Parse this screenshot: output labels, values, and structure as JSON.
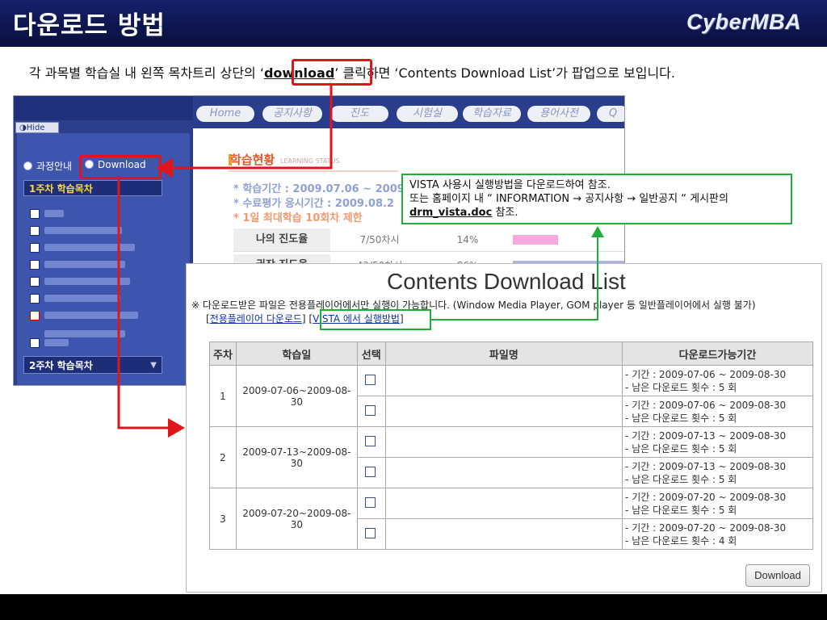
{
  "slide": {
    "title": "다운로드 방법",
    "brand": "CyberMBA",
    "instruction_pre": "각 과목별 학습실 내 왼쪽 목차트리 상단의 ‘",
    "instruction_kw": "download",
    "instruction_post": "’ 클릭하면 ‘Contents Download List’가 팝업으로 보입니다."
  },
  "lms": {
    "hide_label": "Hide",
    "side_tabs": [
      "과정안내",
      "Download"
    ],
    "week1_label": "1주차 학습목차",
    "week2_label": "2주차 학습목차",
    "week2_dropdown": "▼",
    "nav_tabs": [
      "Home",
      "공지사항",
      "진도",
      "시험실",
      "학습자료",
      "용어사전",
      "Q"
    ],
    "section_title": "학습현황",
    "section_sub": "LEARNING STATUS",
    "lines": [
      "* 학습기간 : 2009.07.06 ~ 2009",
      "* 수료평가 응시기간 : 2009.08.2",
      "* 1일 최대학습 10회차 제한"
    ],
    "progress": [
      {
        "label": "나의 진도율",
        "value": "7/50차시",
        "pct": "14%",
        "fraction": 0.14,
        "color": "#f7a8e0"
      },
      {
        "label": "권장 진도율",
        "value": "43/50차시",
        "pct": "86%",
        "fraction": 0.86,
        "color": "#aab4dc"
      }
    ]
  },
  "callout": {
    "line1": "VISTA 사용시 실행방법을 다운로드하여 참조.",
    "line2": "또는 홈페이지 내 “ INFORMATION → 공지사항 → 일반공지 “ 게시판의",
    "doc_name": "drm_vista.doc",
    "line3_suffix": " 참조."
  },
  "popup": {
    "title": "Contents Download List",
    "notice": "※ 다운로드받은 파일은 전용플레이어에서만 실행이 가능합니다. (Window Media Player, GOM player 등 일반플레이어에서 실행 불가)",
    "player_link": "전용플레이어 다운로드",
    "vista_link": "VISTA 에서 실행방법",
    "columns": [
      "주차",
      "학습일",
      "선택",
      "파일명",
      "다운로드가능기간"
    ],
    "weeks": [
      {
        "week": "1",
        "date": "2009-07-06~2009-08-30",
        "rows": [
          {
            "period": "- 기간 : 2009-07-06 ~ 2009-08-30",
            "remaining": "- 남은 다운로드 횟수 : 5 회"
          },
          {
            "period": "- 기간 : 2009-07-06 ~ 2009-08-30",
            "remaining": "- 남은 다운로드 횟수 : 5 회"
          }
        ]
      },
      {
        "week": "2",
        "date": "2009-07-13~2009-08-30",
        "rows": [
          {
            "period": "- 기간 : 2009-07-13 ~ 2009-08-30",
            "remaining": "- 남은 다운로드 횟수 : 5 회"
          },
          {
            "period": "- 기간 : 2009-07-13 ~ 2009-08-30",
            "remaining": "- 남은 다운로드 횟수 : 5 회"
          }
        ]
      },
      {
        "week": "3",
        "date": "2009-07-20~2009-08-30",
        "rows": [
          {
            "period": "- 기간 : 2009-07-20 ~ 2009-08-30",
            "remaining": "- 남은 다운로드 횟수 : 5 회"
          },
          {
            "period": "- 기간 : 2009-07-20 ~ 2009-08-30",
            "remaining": "- 남은 다운로드 횟수 : 4 회"
          }
        ]
      }
    ],
    "download_button": "Download"
  },
  "colors": {
    "header": "#0e1650",
    "annotation_red": "#e0151b",
    "annotation_green": "#1fae3a",
    "sidebar": "#2c3f8c"
  }
}
